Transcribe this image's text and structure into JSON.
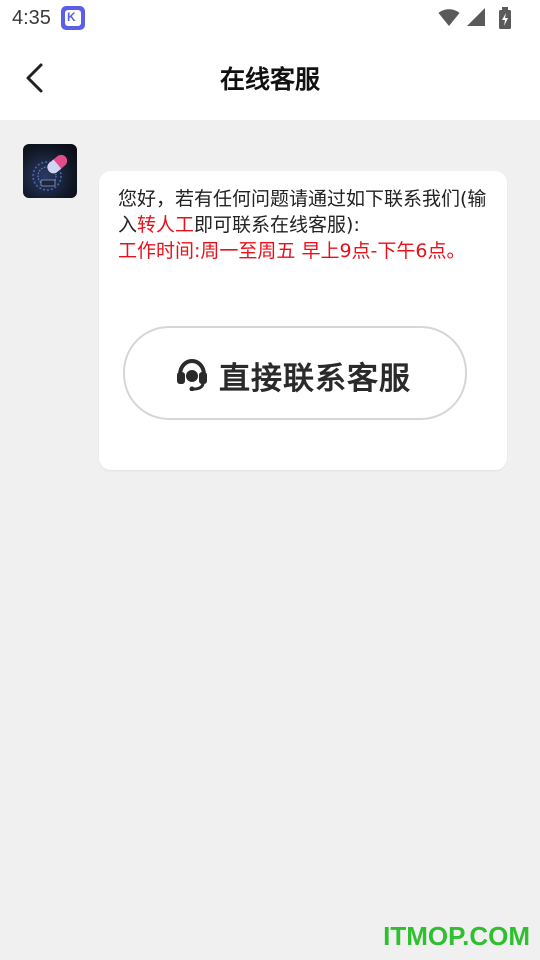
{
  "status_bar": {
    "time": "4:35",
    "app_badge_letter": "K",
    "icons": [
      "wifi-icon",
      "signal-icon",
      "battery-icon"
    ]
  },
  "header": {
    "back_icon": "chevron-left-icon",
    "title": "在线客服"
  },
  "chat": {
    "avatar_icon": "app-logo-avatar",
    "message": {
      "part1": "您好，若有任何问题请通过如下联系我们(输入",
      "highlight": "转人工",
      "part2": "即可联系在线客服):",
      "hours": "工作时间:周一至周五 早上9点-下午6点。"
    },
    "contact_button": {
      "icon": "headset-icon",
      "label": "直接联系客服"
    }
  },
  "watermark": "ITMOP.COM",
  "colors": {
    "background": "#f0f0f0",
    "highlight_red": "#e8101a",
    "watermark_green": "#2fbf2f"
  }
}
